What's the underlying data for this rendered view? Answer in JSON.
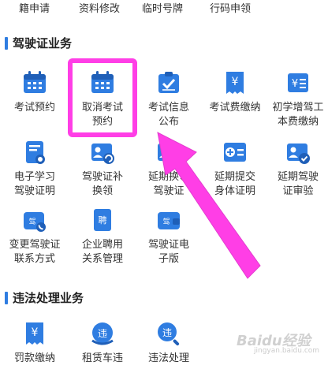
{
  "top_row": [
    "籍申请",
    "资料修改",
    "临时号牌",
    "行码申领"
  ],
  "sections": {
    "license": "驾驶证业务",
    "violation": "违法处理业务"
  },
  "tiles": [
    {
      "label": "考试预约",
      "icon": "calendar-icon"
    },
    {
      "label": "取消考试\n预约",
      "icon": "calendar-icon"
    },
    {
      "label": "考试信息\n公布",
      "icon": "clipboard-check-icon"
    },
    {
      "label": "考试费缴纳",
      "icon": "yen-receipt-icon"
    },
    {
      "label": "初学增驾工\n本费缴纳",
      "icon": "yen-document-icon"
    },
    {
      "label": "电子学习\n驾驶证明",
      "icon": "document-badge-icon"
    },
    {
      "label": "驾驶证补\n换领",
      "icon": "id-card-refresh-icon"
    },
    {
      "label": "延期换领\n驾驶证",
      "icon": "id-card-clock-icon"
    },
    {
      "label": "延期提交\n身体证明",
      "icon": "medical-plus-icon"
    },
    {
      "label": "延期驾驶\n证审验",
      "icon": "id-card-check-icon"
    },
    {
      "label": "变更驾驶证\n联系方式",
      "icon": "wallet-phone-icon"
    },
    {
      "label": "企业聘用\n关系管理",
      "icon": "hire-document-icon"
    },
    {
      "label": "驾驶证电\n子版",
      "icon": "wallet-license-icon"
    },
    {
      "label": "罚款缴纳",
      "icon": "yen-receipt-icon"
    },
    {
      "label": "租赁车违",
      "icon": "violation-badge-icon"
    },
    {
      "label": "违法处理",
      "icon": "violation-search-icon"
    }
  ],
  "watermark": {
    "main": "Baidu经验",
    "sub": "jingyan.baidu.com"
  },
  "colors": {
    "accent": "#2f7de1",
    "highlight": "#ff3ee6"
  }
}
